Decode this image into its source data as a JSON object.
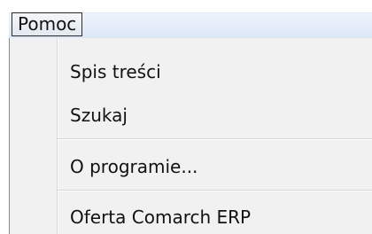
{
  "menubar": {
    "title": "Pomoc"
  },
  "menu": {
    "items": [
      {
        "label": "Spis treści"
      },
      {
        "label": "Szukaj"
      },
      {
        "label": "O programie..."
      },
      {
        "label": "Oferta Comarch ERP"
      }
    ]
  }
}
